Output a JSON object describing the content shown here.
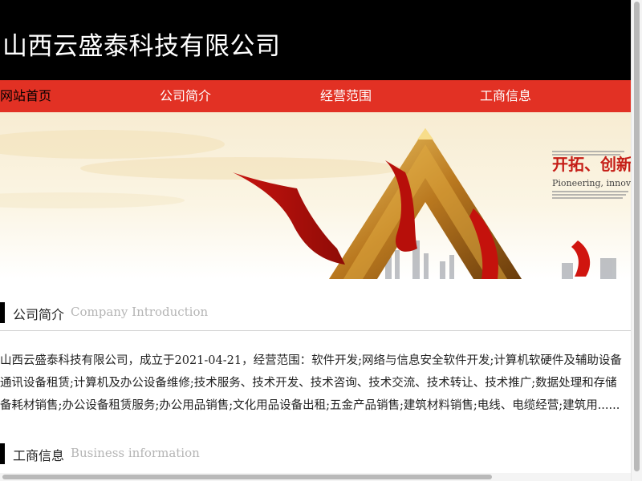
{
  "header": {
    "title": "山西云盛泰科技有限公司"
  },
  "nav": {
    "items": [
      {
        "label": "网站首页",
        "active": true
      },
      {
        "label": "公司简介",
        "active": false
      },
      {
        "label": "经营范围",
        "active": false
      },
      {
        "label": "工商信息",
        "active": false
      }
    ]
  },
  "banner": {
    "headline": "开拓、创新",
    "subline": "Pioneering, innovat"
  },
  "sections": {
    "intro": {
      "title": "公司简介",
      "subtitle": "Company Introduction"
    },
    "business": {
      "title": "工商信息",
      "subtitle": "Business information"
    }
  },
  "intro_lines": [
    "山西云盛泰科技有限公司，成立于2021-04-21，经营范围：软件开发;网络与信息安全软件开发;计算机软硬件及辅助设备",
    "通讯设备租赁;计算机及办公设备维修;技术服务、技术开发、技术咨询、技术交流、技术转让、技术推广;数据处理和存储",
    "备耗材销售;办公设备租赁服务;办公用品销售;文化用品设备出租;五金产品销售;建筑材料销售;电线、电缆经营;建筑用......"
  ],
  "colors": {
    "header_bg": "#000000",
    "nav_bg": "#e23124",
    "section_bar": "#000000"
  }
}
